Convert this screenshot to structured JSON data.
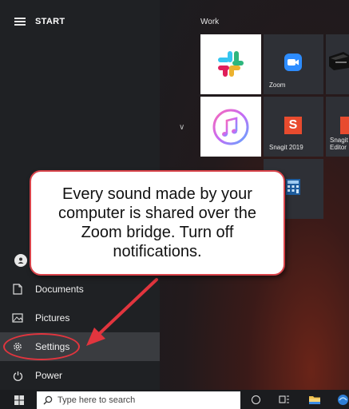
{
  "start_menu": {
    "title": "START",
    "left_items": [
      {
        "label": "Documents",
        "icon": "document-icon"
      },
      {
        "label": "Pictures",
        "icon": "picture-icon"
      },
      {
        "label": "Settings",
        "icon": "gear-icon"
      },
      {
        "label": "Power",
        "icon": "power-icon"
      }
    ],
    "group_title": "Work",
    "tiles": [
      {
        "label": "",
        "icon": "slack-icon"
      },
      {
        "label": "Zoom",
        "icon": "zoom-icon"
      },
      {
        "label": "",
        "icon": "itunes-icon"
      },
      {
        "label": "Snagit 2019",
        "icon": "snagit-icon"
      },
      {
        "label": "Snagit Editor",
        "icon": "snagit-editor-icon"
      },
      {
        "label": "lator",
        "icon": "calculator-icon"
      }
    ]
  },
  "taskbar": {
    "search_placeholder": "Type here to search"
  },
  "annotation": {
    "callout_text": "Every sound made by your computer is shared over the Zoom bridge. Turn off notifications.",
    "accent_color": "#e1353e"
  }
}
